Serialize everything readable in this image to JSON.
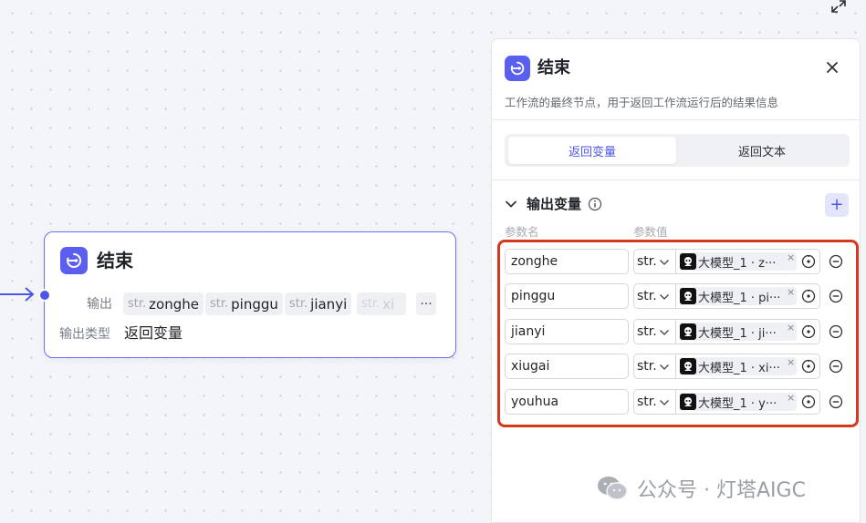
{
  "canvas": {
    "expand_icon": "expand-icon"
  },
  "node": {
    "title": "结束",
    "output_label": "输出",
    "output_type_label": "输出类型",
    "output_type_value": "返回变量",
    "outputs": [
      {
        "type": "str.",
        "name": "zonghe"
      },
      {
        "type": "str.",
        "name": "pinggu"
      },
      {
        "type": "str.",
        "name": "jianyi"
      },
      {
        "type": "str.",
        "name": "xi"
      }
    ],
    "more_label": "···"
  },
  "panel": {
    "title": "结束",
    "description": "工作流的最终节点，用于返回工作流运行后的结果信息",
    "tabs": [
      {
        "label": "返回变量",
        "active": true
      },
      {
        "label": "返回文本",
        "active": false
      }
    ],
    "section_title": "输出变量",
    "add_label": "+",
    "col_name": "参数名",
    "col_value": "参数值",
    "rows": [
      {
        "name": "zonghe",
        "type": "str.",
        "value": "大模型_1 · z···"
      },
      {
        "name": "pinggu",
        "type": "str.",
        "value": "大模型_1 · pi···"
      },
      {
        "name": "jianyi",
        "type": "str.",
        "value": "大模型_1 · ji···"
      },
      {
        "name": "xiugai",
        "type": "str.",
        "value": "大模型_1 · xi···"
      },
      {
        "name": "youhua",
        "type": "str.",
        "value": "大模型_1 · y···"
      }
    ],
    "chip_close": "×"
  },
  "watermark": {
    "text": "公众号 · 灯塔AIGC"
  },
  "colors": {
    "accent": "#5b5ff0",
    "highlight": "#d4391e"
  }
}
